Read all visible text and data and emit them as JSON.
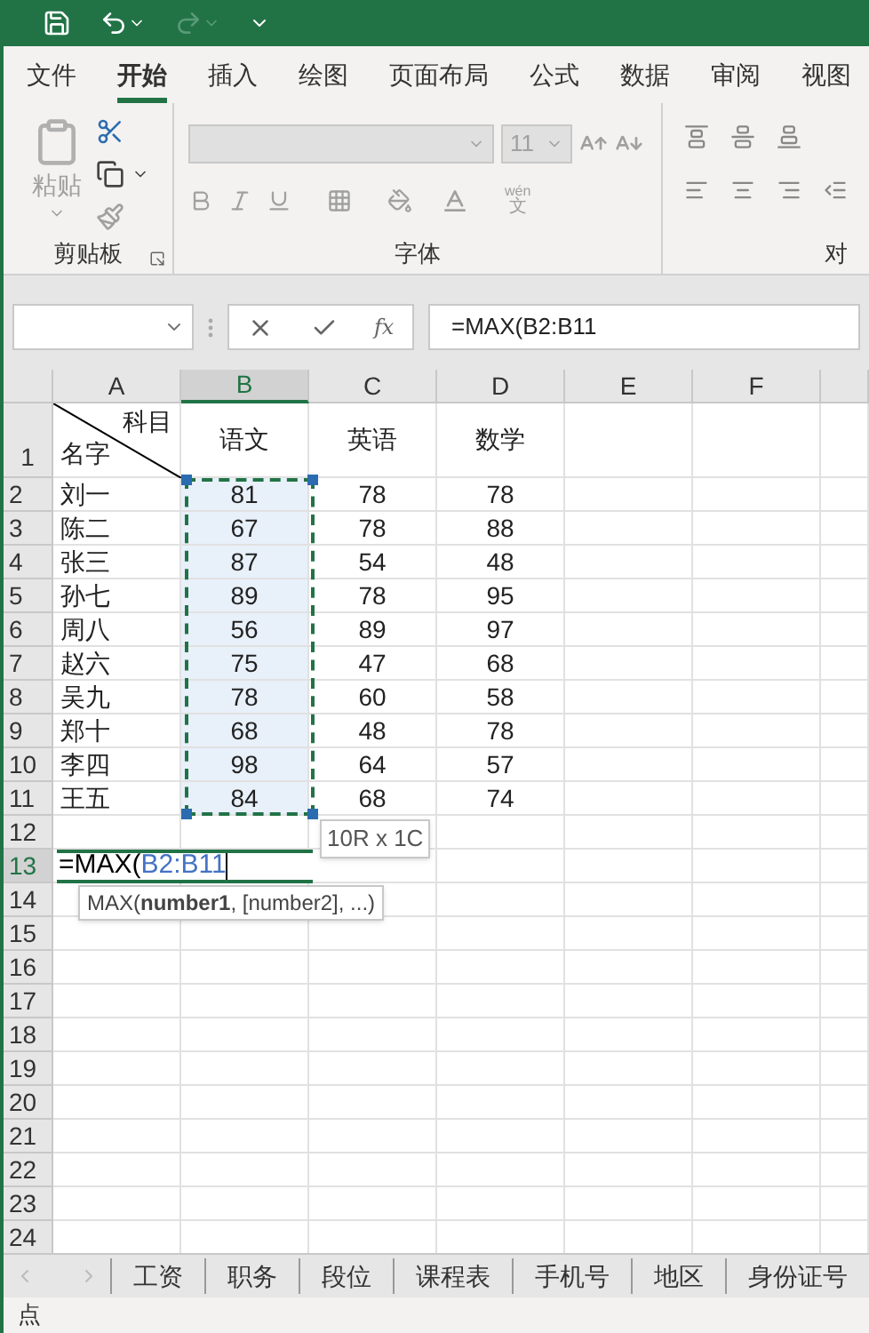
{
  "menu_tabs": [
    {
      "label": "文件",
      "selected": false
    },
    {
      "label": "开始",
      "selected": true
    },
    {
      "label": "插入",
      "selected": false
    },
    {
      "label": "绘图",
      "selected": false
    },
    {
      "label": "页面布局",
      "selected": false
    },
    {
      "label": "公式",
      "selected": false
    },
    {
      "label": "数据",
      "selected": false
    },
    {
      "label": "审阅",
      "selected": false
    },
    {
      "label": "视图",
      "selected": false
    }
  ],
  "ribbon": {
    "paste_label": "粘贴",
    "font_size": "11",
    "phonetic": {
      "pinyin": "wén",
      "char": "文"
    },
    "groups": [
      "剪贴板",
      "字体",
      "对"
    ]
  },
  "formula_bar": {
    "function_label": "fx",
    "formula": "=MAX(B2:B11"
  },
  "sheet": {
    "columns": [
      {
        "label": "A",
        "selected": false
      },
      {
        "label": "B",
        "selected": true
      },
      {
        "label": "C",
        "selected": false
      },
      {
        "label": "D",
        "selected": false
      },
      {
        "label": "E",
        "selected": false
      },
      {
        "label": "F",
        "selected": false
      }
    ],
    "header_cell": {
      "top": "科目",
      "bottom": "名字"
    },
    "header_row": {
      "number": "1",
      "cells": [
        "语文",
        "英语",
        "数学"
      ]
    },
    "rows": [
      {
        "number": "2",
        "selected": false,
        "in_range": true,
        "cells": [
          "刘一",
          "81",
          "78",
          "78"
        ]
      },
      {
        "number": "3",
        "selected": false,
        "in_range": true,
        "cells": [
          "陈二",
          "67",
          "78",
          "88"
        ]
      },
      {
        "number": "4",
        "selected": false,
        "in_range": true,
        "cells": [
          "张三",
          "87",
          "54",
          "48"
        ]
      },
      {
        "number": "5",
        "selected": false,
        "in_range": true,
        "cells": [
          "孙七",
          "89",
          "78",
          "95"
        ]
      },
      {
        "number": "6",
        "selected": false,
        "in_range": true,
        "cells": [
          "周八",
          "56",
          "89",
          "97"
        ]
      },
      {
        "number": "7",
        "selected": false,
        "in_range": true,
        "cells": [
          "赵六",
          "75",
          "47",
          "68"
        ]
      },
      {
        "number": "8",
        "selected": false,
        "in_range": true,
        "cells": [
          "吴九",
          "78",
          "60",
          "58"
        ]
      },
      {
        "number": "9",
        "selected": false,
        "in_range": true,
        "cells": [
          "郑十",
          "68",
          "48",
          "78"
        ]
      },
      {
        "number": "10",
        "selected": false,
        "in_range": true,
        "cells": [
          "李四",
          "98",
          "64",
          "57"
        ]
      },
      {
        "number": "11",
        "selected": false,
        "in_range": true,
        "cells": [
          "王五",
          "84",
          "68",
          "74"
        ]
      },
      {
        "number": "12",
        "selected": false,
        "in_range": false,
        "cells": []
      },
      {
        "number": "13",
        "selected": true,
        "in_range": false,
        "cells": [],
        "editor": {
          "prefix": "=MAX(",
          "reference": "B2:B11"
        }
      },
      {
        "number": "14",
        "selected": false,
        "in_range": false,
        "cells": []
      },
      {
        "number": "15",
        "selected": false,
        "in_range": false,
        "cells": []
      },
      {
        "number": "16",
        "selected": false,
        "in_range": false,
        "cells": []
      },
      {
        "number": "17",
        "selected": false,
        "in_range": false,
        "cells": []
      },
      {
        "number": "18",
        "selected": false,
        "in_range": false,
        "cells": []
      },
      {
        "number": "19",
        "selected": false,
        "in_range": false,
        "cells": []
      },
      {
        "number": "20",
        "selected": false,
        "in_range": false,
        "cells": []
      },
      {
        "number": "21",
        "selected": false,
        "in_range": false,
        "cells": []
      },
      {
        "number": "22",
        "selected": false,
        "in_range": false,
        "cells": []
      },
      {
        "number": "23",
        "selected": false,
        "in_range": false,
        "cells": []
      },
      {
        "number": "24",
        "selected": false,
        "in_range": false,
        "cells": []
      }
    ],
    "range_tooltip": "10R x 1C",
    "function_hint": "MAX(**number1**, [number2], ...)"
  },
  "sheet_tabs": [
    {
      "label": "工资",
      "selected": false
    },
    {
      "label": "职务",
      "selected": false
    },
    {
      "label": "段位",
      "selected": false
    },
    {
      "label": "课程表",
      "selected": false
    },
    {
      "label": "手机号",
      "selected": false
    },
    {
      "label": "地区",
      "selected": false
    },
    {
      "label": "身份证号",
      "selected": false
    }
  ],
  "status_bar": {
    "mode": "点"
  }
}
